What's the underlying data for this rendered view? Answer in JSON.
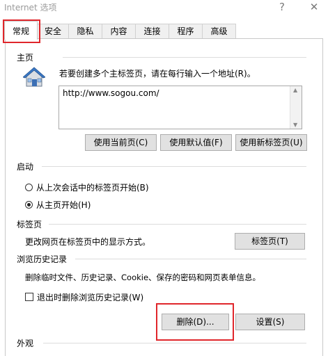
{
  "window": {
    "title": "Internet 选项",
    "help_label": "?",
    "close_label": "✕"
  },
  "tabs": [
    {
      "label": "常规"
    },
    {
      "label": "安全"
    },
    {
      "label": "隐私"
    },
    {
      "label": "内容"
    },
    {
      "label": "连接"
    },
    {
      "label": "程序"
    },
    {
      "label": "高级"
    }
  ],
  "homepage": {
    "section_title": "主页",
    "instruction": "若要创建多个主标签页，请在每行输入一个地址(R)。",
    "url_value": "http://www.sogou.com/",
    "use_current_label": "使用当前页(C)",
    "use_default_label": "使用默认值(F)",
    "use_new_tab_label": "使用新标签页(U)"
  },
  "startup": {
    "section_title": "启动",
    "option_last_session": "从上次会话中的标签页开始(B)",
    "option_homepage": "从主页开始(H)",
    "selected": "homepage"
  },
  "tabs_section": {
    "section_title": "标签页",
    "description": "更改网页在标签页中的显示方式。",
    "button_label": "标签页(T)"
  },
  "history": {
    "section_title": "浏览历史记录",
    "description": "删除临时文件、历史记录、Cookie、保存的密码和网页表单信息。",
    "delete_on_exit_label": "退出时删除浏览历史记录(W)",
    "delete_on_exit_checked": false,
    "delete_label": "删除(D)...",
    "settings_label": "设置(S)"
  },
  "appearance": {
    "section_title": "外观"
  },
  "colors": {
    "highlight": "#e0262b",
    "tab_bg": "#f0f0f0",
    "button_bg": "#e1e1e1"
  }
}
